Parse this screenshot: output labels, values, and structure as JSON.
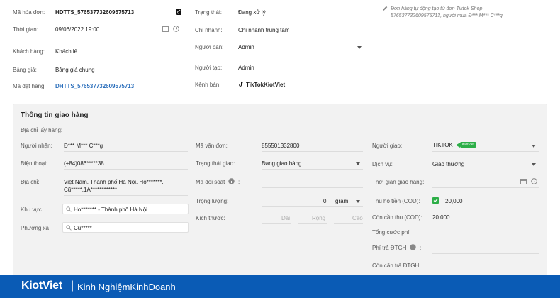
{
  "invoice": {
    "invoice_code_label": "Mã hóa đơn:",
    "invoice_code": "HDTTS_576537732609575713",
    "time_label": "Thời gian:",
    "time": "09/06/2022 19:00",
    "customer_label": "Khách hàng:",
    "customer": "Khách lẻ",
    "price_list_label": "Bảng giá:",
    "price_list": "Bảng giá chung",
    "order_code_label": "Mã đặt hàng:",
    "order_code": "DHTTS_576537732609575713",
    "status_label": "Trạng thái:",
    "status": "Đang xử lý",
    "branch_label": "Chi nhánh:",
    "branch": "Chi nhánh trung tâm",
    "seller_label": "Người bán:",
    "seller": "Admin",
    "creator_label": "Người tạo:",
    "creator": "Admin",
    "channel_label": "Kênh bán:",
    "channel": "TikTokKiotViet",
    "note": "Đơn hàng tự động tạo từ đơn Tiktok Shop 576537732609575713, người mua Đ*** M*** C***g."
  },
  "delivery": {
    "title": "Thông tin giao hàng",
    "pickup_address_label": "Địa chỉ lấy hàng:",
    "receiver_label": "Người nhận:",
    "receiver": "Đ*** M*** C***g",
    "phone_label": "Điện thoại:",
    "phone": "(+84)086*****38",
    "address_label": "Địa chỉ:",
    "address_line1": "Việt Nam, Thành phố Hà Nội, Ho*******,",
    "address_line2": "Cũ*****,1A************",
    "area_label": "Khu vực",
    "area": "Ho******* - Thành phố Hà Nội",
    "ward_label": "Phường xã",
    "ward": "Cũ*****",
    "tracking_label": "Mã vận đơn:",
    "tracking": "855501332800",
    "delivery_status_label": "Trạng thái giao:",
    "delivery_status": "Đang giao hàng",
    "reconcile_label": "Mã đối soát",
    "reconcile_colon": ":",
    "weight_label": "Trọng lượng:",
    "weight_value": "0",
    "weight_unit": "gram",
    "size_label": "Kích thước:",
    "size_length": "Dài",
    "size_width": "Rộng",
    "size_height": "Cao",
    "shipper_label": "Người giao:",
    "shipper": "TIKTOK",
    "shipper_tag": "KiotViet",
    "service_label": "Dịch vụ:",
    "service": "Giao thường",
    "delivery_time_label": "Thời gian giao hàng:",
    "cod_label": "Thu hộ tiền (COD):",
    "cod_value": "20,000",
    "cod_remaining_label": "Còn cần thu (COD):",
    "cod_remaining": "20.000",
    "total_fee_label": "Tổng cước phí:",
    "fee_dtgh_label": "Phí trả ĐTGH",
    "fee_dtgh_colon": ":",
    "remaining_dtgh_label": "Còn cần trả ĐTGH:"
  },
  "footer": {
    "brand": "KiotViet",
    "separator": "|",
    "tagline": "Kinh NghiệmKinhDoanh"
  },
  "colors": {
    "footer_bg": "#0a5bb5",
    "link": "#2a6ebb",
    "tag_green": "#2cae47"
  }
}
